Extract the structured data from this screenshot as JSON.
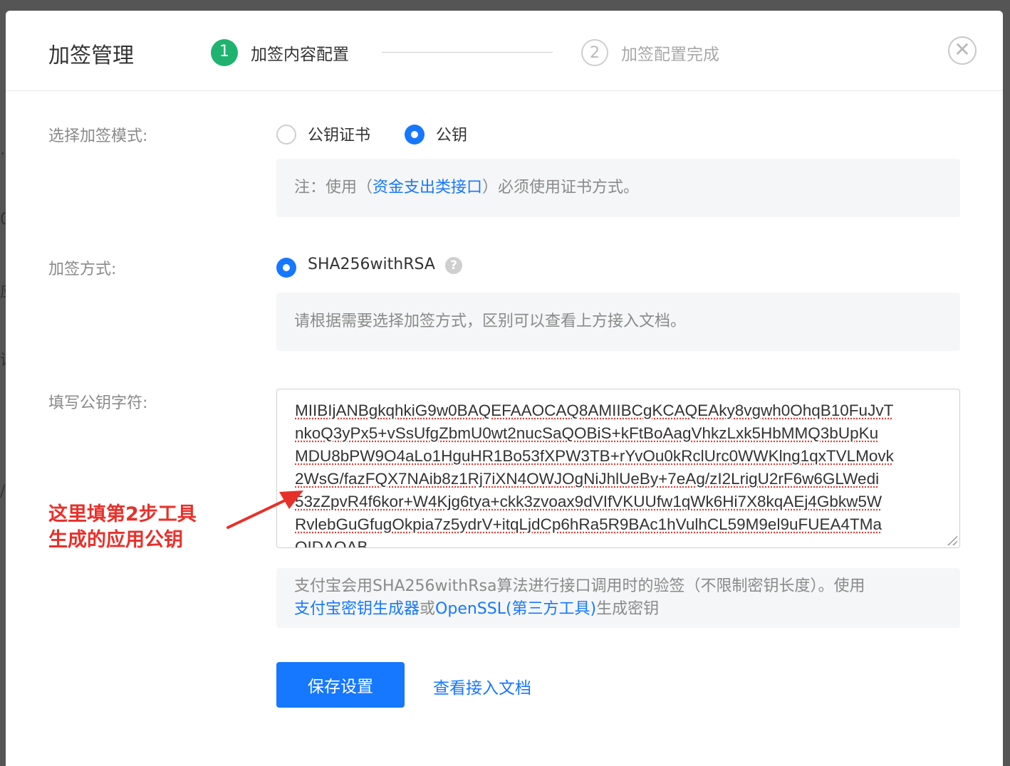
{
  "background_hints": [
    ".",
    "0",
    "应",
    "证",
    "/"
  ],
  "header": {
    "title": "加签管理",
    "steps": [
      {
        "number": "1",
        "label": "加签内容配置",
        "state": "active"
      },
      {
        "number": "2",
        "label": "加签配置完成",
        "state": "pending"
      }
    ],
    "close_symbol": "✕"
  },
  "sign_mode": {
    "label": "选择加签模式:",
    "options": [
      {
        "label": "公钥证书",
        "selected": false
      },
      {
        "label": "公钥",
        "selected": true
      }
    ],
    "note_prefix": "注：使用（",
    "note_link": "资金支出类接口",
    "note_suffix": "）必须使用证书方式。"
  },
  "sign_method": {
    "label": "加签方式:",
    "option": "SHA256withRSA",
    "help": "?",
    "note": "请根据需要选择加签方式，区别可以查看上方接入文档。"
  },
  "public_key": {
    "label": "填写公钥字符:",
    "lines": [
      "MIIBIjANBgkqhkiG9w0BAQEFAAOCAQ8AMIIBCgKCAQEAky8vgwh0OhqB10FuJvT",
      "nkoQ3yPx5+vSsUfgZbmU0wt2nucSaQOBiS+kFtBoAagVhkzLxk5HbMMQ3bUpKu",
      "MDU8bPW9O4aLo1HguHR1Bo53fXPW3TB+rYvOu0kRclUrc0WWKlng1qxTVLMovk",
      "2WsG/fazFQX7NAib8z1Rj7iXN4OWJOgNiJhlUeBy+7eAg/zI2LrigU2rF6w6GLWedi",
      "53zZpvR4f6kor+W4Kjg6tya+ckk3zvoax9dVIfVKUUfw1qWk6Hi7X8kqAEj4Gbkw5W",
      "RvlebGuGfugOkpia7z5ydrV+itqLjdCp6hRa5R9BAc1hVulhCL59M9el9uFUEA4TMa",
      "QIDAQAB"
    ],
    "note_text": "支付宝会用SHA256withRsa算法进行接口调用时的验签（不限制密钥长度）。使用",
    "note_link_1": "支付宝密钥生成器",
    "note_mid": "或",
    "note_link_2": "OpenSSL(第三方工具)",
    "note_end": "生成密钥"
  },
  "annotation": {
    "line1": "这里填第2步工具",
    "line2": "生成的应用公钥",
    "color": "#e8302a"
  },
  "actions": {
    "save": "保存设置",
    "doc": "查看接入文档"
  },
  "colors": {
    "primary": "#1677ff",
    "step_active": "#1fb36f"
  }
}
